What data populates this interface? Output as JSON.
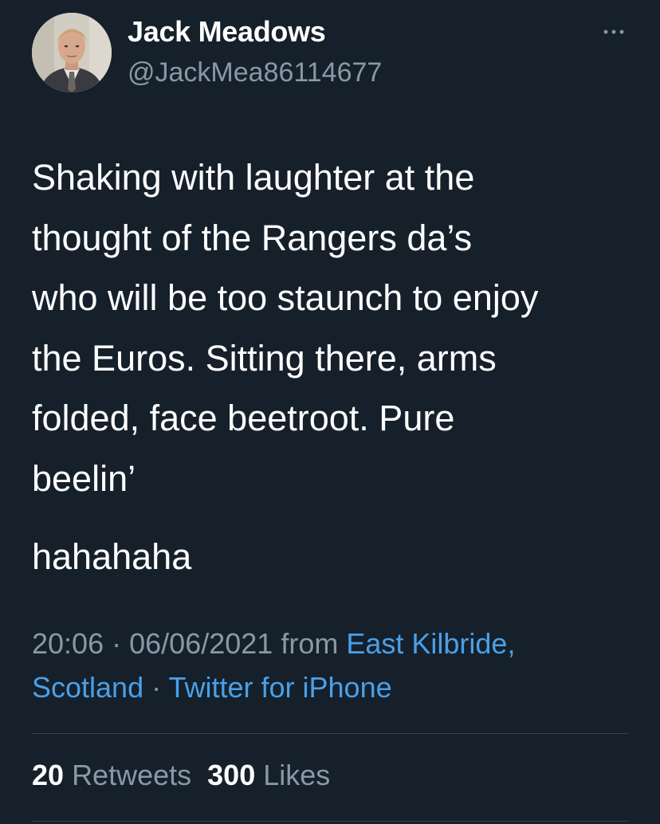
{
  "user": {
    "display_name": "Jack Meadows",
    "handle": "@JackMea86114677"
  },
  "tweet": {
    "text": "Shaking with laughter at the\nthought of the Rangers da’s\nwho will be too staunch to enjoy\nthe Euros. Sitting there, arms\nfolded, face beetroot. Pure\nbeelin’",
    "text_2": "hahahaha",
    "time": "20:06",
    "date": "06/06/2021",
    "from_label": "from",
    "location_line1": "East Kilbride,",
    "location_line2": "Scotland",
    "source": "Twitter for iPhone",
    "separator": "·"
  },
  "stats": {
    "retweets_count": "20",
    "retweets_label": "Retweets",
    "likes_count": "300",
    "likes_label": "Likes"
  },
  "icons": {
    "more": "more-horizontal-icon"
  },
  "colors": {
    "background": "#15202b",
    "primary_text": "#ffffff",
    "secondary_text": "#8899a6",
    "link": "#4aa0e8",
    "divider": "#38444d"
  }
}
